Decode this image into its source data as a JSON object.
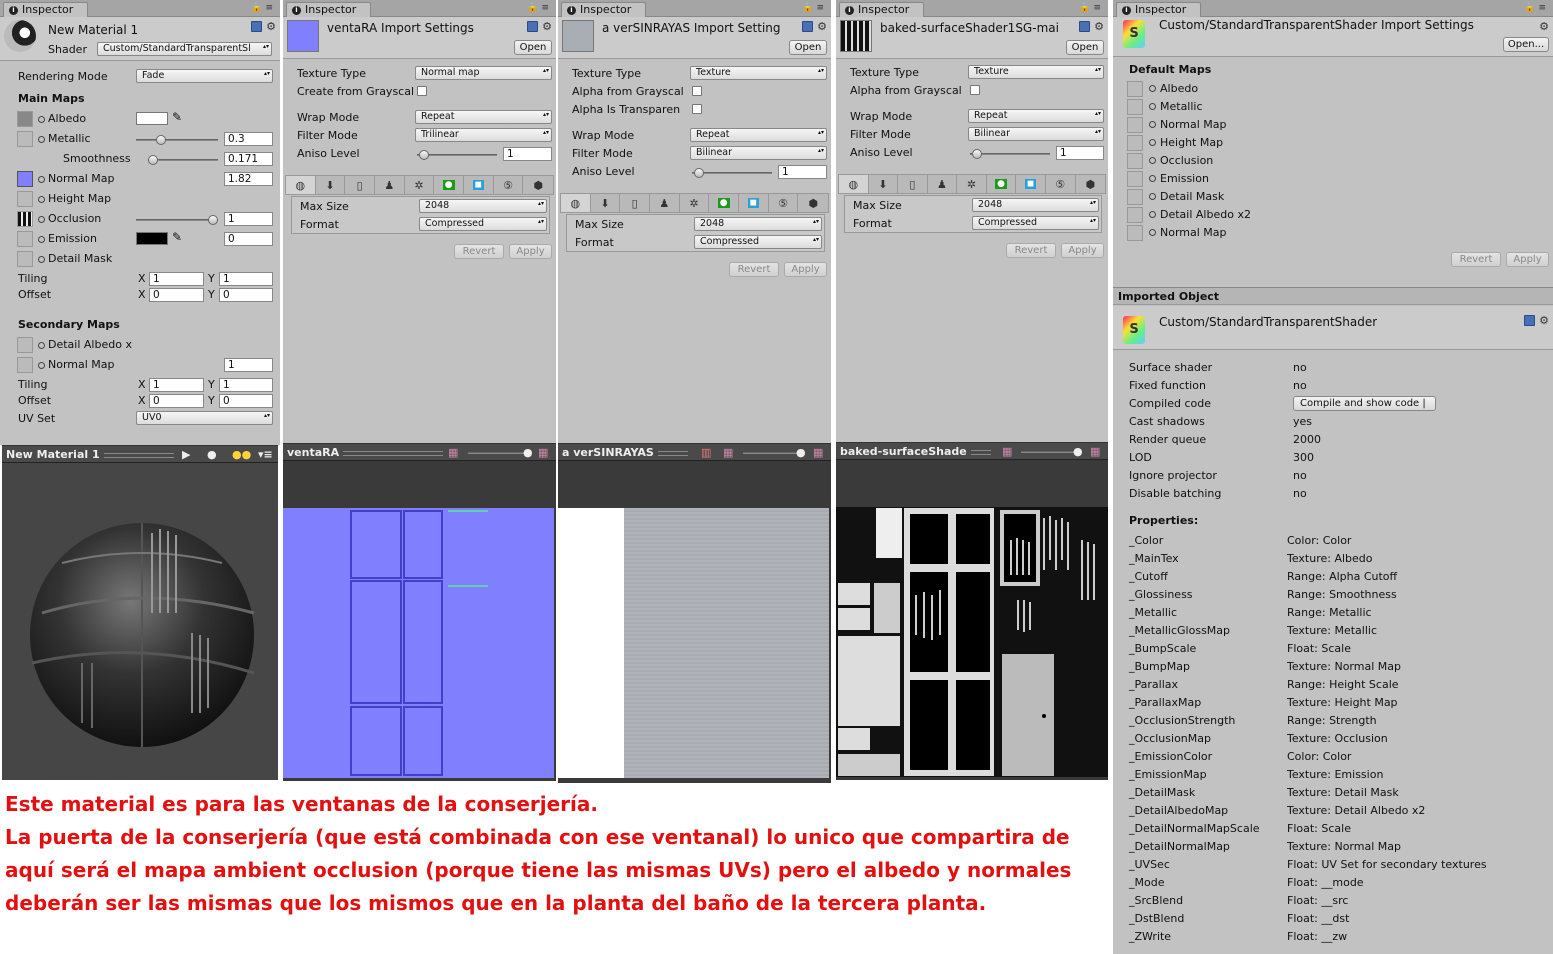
{
  "tab_label": "Inspector",
  "p1": {
    "title": "New Material 1",
    "shader_label": "Shader",
    "shader_value": "Custom/StandardTransparentSl",
    "rendering_mode_label": "Rendering Mode",
    "rendering_mode_value": "Fade",
    "main_maps_heading": "Main Maps",
    "albedo": "Albedo",
    "metallic": "Metallic",
    "metallic_value": "0.3",
    "smoothness": "Smoothness",
    "smoothness_value": "0.171",
    "normal_map": "Normal Map",
    "normal_value": "1.82",
    "height_map": "Height Map",
    "occlusion": "Occlusion",
    "occlusion_value": "1",
    "emission": "Emission",
    "emission_value": "0",
    "detail_mask": "Detail Mask",
    "tiling": "Tiling",
    "offset": "Offset",
    "x": "X",
    "y": "Y",
    "tiling_x": "1",
    "tiling_y": "1",
    "offset_x": "0",
    "offset_y": "0",
    "secondary_maps_heading": "Secondary Maps",
    "detail_albedo": "Detail Albedo x",
    "sec_normal_map": "Normal Map",
    "sec_normal_value": "1",
    "sec_tiling_x": "1",
    "sec_tiling_y": "1",
    "sec_offset_x": "0",
    "sec_offset_y": "0",
    "uv_set_label": "UV Set",
    "uv_set_value": "UV0",
    "preview_title": "New Material 1"
  },
  "p2": {
    "title": "ventaRA Import Settings",
    "open": "Open",
    "texture_type_label": "Texture Type",
    "texture_type_value": "Normal map",
    "create_from_grayscale": "Create from Grayscal",
    "wrap_mode_label": "Wrap Mode",
    "wrap_mode_value": "Repeat",
    "filter_mode_label": "Filter Mode",
    "filter_mode_value": "Trilinear",
    "aniso_label": "Aniso Level",
    "aniso_value": "1",
    "max_size_label": "Max Size",
    "max_size_value": "2048",
    "format_label": "Format",
    "format_value": "Compressed",
    "revert": "Revert",
    "apply": "Apply",
    "preview_title": "ventaRA"
  },
  "p3": {
    "title": "a verSINRAYAS Import Setting",
    "open": "Open",
    "texture_type_label": "Texture Type",
    "texture_type_value": "Texture",
    "alpha_from_grayscale": "Alpha from Grayscal",
    "alpha_is_transparent": "Alpha Is Transparen",
    "wrap_mode_label": "Wrap Mode",
    "wrap_mode_value": "Repeat",
    "filter_mode_label": "Filter Mode",
    "filter_mode_value": "Bilinear",
    "aniso_label": "Aniso Level",
    "aniso_value": "1",
    "max_size_label": "Max Size",
    "max_size_value": "2048",
    "format_label": "Format",
    "format_value": "Compressed",
    "revert": "Revert",
    "apply": "Apply",
    "preview_title": "a verSINRAYAS"
  },
  "p4": {
    "title": "baked-surfaceShader1SG-mai",
    "open": "Open",
    "texture_type_label": "Texture Type",
    "texture_type_value": "Texture",
    "alpha_from_grayscale": "Alpha from Grayscal",
    "wrap_mode_label": "Wrap Mode",
    "wrap_mode_value": "Repeat",
    "filter_mode_label": "Filter Mode",
    "filter_mode_value": "Bilinear",
    "aniso_label": "Aniso Level",
    "aniso_value": "1",
    "max_size_label": "Max Size",
    "max_size_value": "2048",
    "format_label": "Format",
    "format_value": "Compressed",
    "revert": "Revert",
    "apply": "Apply",
    "preview_title": "baked-surfaceShade"
  },
  "p5": {
    "title": "Custom/StandardTransparentShader Import Settings",
    "open": "Open...",
    "default_maps_heading": "Default Maps",
    "default_maps": [
      "Albedo",
      "Metallic",
      "Normal Map",
      "Height Map",
      "Occlusion",
      "Emission",
      "Detail Mask",
      "Detail Albedo x2",
      "Normal Map"
    ],
    "revert": "Revert",
    "apply": "Apply",
    "imported_object_heading": "Imported Object",
    "object_title": "Custom/StandardTransparentShader",
    "info": [
      {
        "k": "Surface shader",
        "v": "no"
      },
      {
        "k": "Fixed function",
        "v": "no"
      },
      {
        "k": "Compiled code",
        "v": ""
      },
      {
        "k": "Cast shadows",
        "v": "yes"
      },
      {
        "k": "Render queue",
        "v": "2000"
      },
      {
        "k": "LOD",
        "v": "300"
      },
      {
        "k": "Ignore projector",
        "v": "no"
      },
      {
        "k": "Disable batching",
        "v": "no"
      }
    ],
    "compile_button": "Compile and show code |",
    "properties_heading": "Properties:",
    "properties": [
      {
        "k": "_Color",
        "v": "Color: Color"
      },
      {
        "k": "_MainTex",
        "v": "Texture: Albedo"
      },
      {
        "k": "_Cutoff",
        "v": "Range: Alpha Cutoff"
      },
      {
        "k": "_Glossiness",
        "v": "Range: Smoothness"
      },
      {
        "k": "_Metallic",
        "v": "Range: Metallic"
      },
      {
        "k": "_MetallicGlossMap",
        "v": "Texture: Metallic"
      },
      {
        "k": "_BumpScale",
        "v": "Float: Scale"
      },
      {
        "k": "_BumpMap",
        "v": "Texture: Normal Map"
      },
      {
        "k": "_Parallax",
        "v": "Range: Height Scale"
      },
      {
        "k": "_ParallaxMap",
        "v": "Texture: Height Map"
      },
      {
        "k": "_OcclusionStrength",
        "v": "Range: Strength"
      },
      {
        "k": "_OcclusionMap",
        "v": "Texture: Occlusion"
      },
      {
        "k": "_EmissionColor",
        "v": "Color: Color"
      },
      {
        "k": "_EmissionMap",
        "v": "Texture: Emission"
      },
      {
        "k": "_DetailMask",
        "v": "Texture: Detail Mask"
      },
      {
        "k": "_DetailAlbedoMap",
        "v": "Texture: Detail Albedo x2"
      },
      {
        "k": "_DetailNormalMapScale",
        "v": "Float: Scale"
      },
      {
        "k": "_DetailNormalMap",
        "v": "Texture: Normal Map"
      },
      {
        "k": "_UVSec",
        "v": "Float: UV Set for secondary textures"
      },
      {
        "k": "_Mode",
        "v": "Float: __mode"
      },
      {
        "k": "_SrcBlend",
        "v": "Float: __src"
      },
      {
        "k": "_DstBlend",
        "v": "Float: __dst"
      },
      {
        "k": "_ZWrite",
        "v": "Float: __zw"
      }
    ]
  },
  "note": {
    "line1": "Este material es para las ventanas de la conserjería.",
    "line2": "La puerta de la conserjería (que está combinada con ese ventanal) lo unico que compartira de",
    "line3": "aquí será el mapa ambient occlusion (porque tiene las mismas UVs) pero el albedo y normales",
    "line4": "deberán ser las mismas que los mismos que en la planta del baño de la tercera planta."
  },
  "colors": {
    "normal_map_fill": "#8080ff",
    "note_red": "#e41010",
    "panel_bg": "#c2c2c2"
  }
}
